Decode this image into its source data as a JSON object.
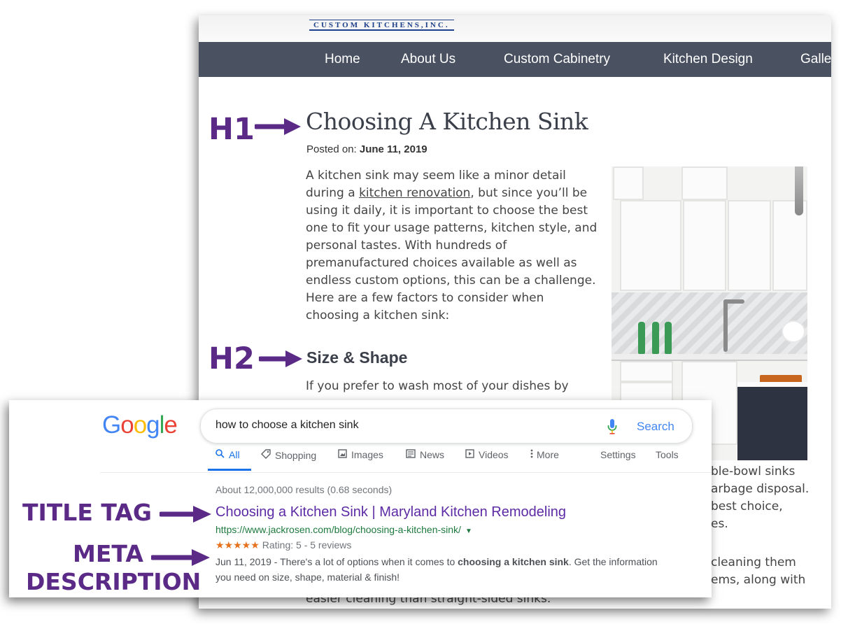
{
  "site": {
    "logo_text": "CUSTOM KITCHENS,INC.",
    "nav": [
      "Home",
      "About Us",
      "Custom Cabinetry",
      "Kitchen Design",
      "Galle"
    ],
    "h1": "Choosing A Kitchen Sink",
    "posted_label": "Posted on: ",
    "posted_date": "June 11, 2019",
    "intro_before_link": "A kitchen sink may seem like a minor detail during a ",
    "intro_link": "kitchen renovation",
    "intro_after_link": ", but since you’ll be using it daily, it is important to choose the best one to fit your usage patterns, kitchen style, and personal tastes. With hundreds of premanufactured choices available as well as endless custom options, this can be a challenge. Here are a few factors to consider when choosing a kitchen sink:",
    "h2": "Size & Shape",
    "p2_line1": "If you prefer to wash most of your dishes by",
    "right_lines": [
      "ble-bowl sinks",
      "arbage disposal.",
      "best choice,",
      "es.",
      "cleaning them",
      "ems, along with"
    ],
    "bottom_line": "easier cleaning than straight-sided sinks."
  },
  "serp": {
    "logo": [
      "G",
      "o",
      "o",
      "g",
      "l",
      "e"
    ],
    "logo_colors": [
      "#4285f4",
      "#ea4335",
      "#fbbc05",
      "#4285f4",
      "#34a853",
      "#ea4335"
    ],
    "query": "how to choose a kitchen sink",
    "search_button": "Search",
    "tabs": [
      {
        "label": "All",
        "icon": "search-icon"
      },
      {
        "label": "Shopping",
        "icon": "tag-icon"
      },
      {
        "label": "Images",
        "icon": "image-icon"
      },
      {
        "label": "News",
        "icon": "news-icon"
      },
      {
        "label": "Videos",
        "icon": "video-icon"
      },
      {
        "label": "More",
        "icon": "more-vertical-icon"
      },
      {
        "label": "Settings",
        "icon": ""
      },
      {
        "label": "Tools",
        "icon": ""
      }
    ],
    "result_count": "About 12,000,000 results (0.68 seconds)",
    "result_title": "Choosing a Kitchen Sink | Maryland Kitchen Remodeling",
    "result_url": "https://www.jackrosen.com/blog/choosing-a-kitchen-sink/",
    "stars": "★★★★★",
    "rating_text": "Rating: 5 - 5 reviews",
    "snippet_prefix": "Jun 11, 2019 - There's a lot of options when it comes to ",
    "snippet_bold": "choosing a kitchen sink",
    "snippet_suffix": ". Get the information you need on size, shape, material & finish!"
  },
  "annotations": {
    "h1": "H1",
    "h2": "H2",
    "title_tag": "TITLE TAG",
    "meta_line1": "META",
    "meta_line2": "DESCRIPTION",
    "color": "#5a2a86"
  }
}
